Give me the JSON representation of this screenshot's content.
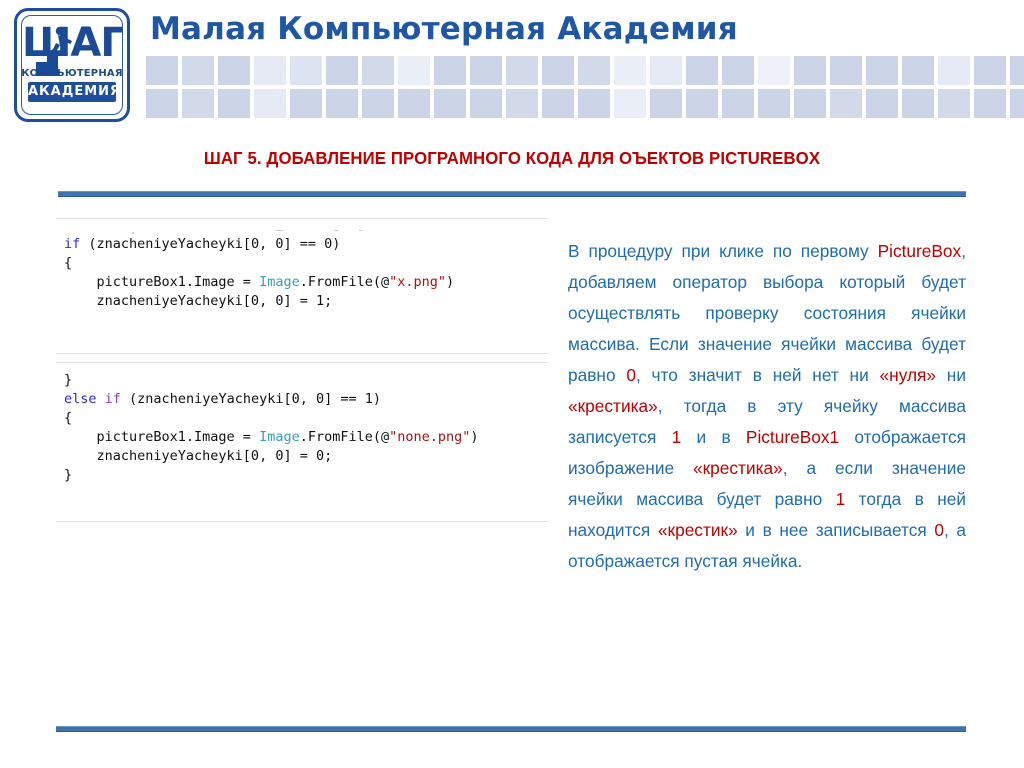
{
  "header": {
    "academy_title": "Малая Компьютерная Академия",
    "logo": {
      "main_word": "ШАГ",
      "line1": "КОМПЬЮТЕРНАЯ",
      "line2": "АКАДЕМИЯ"
    },
    "accent_blue": "#1f57a4",
    "checker_rows": [
      [
        "#ccd4e8",
        "#d2dae9",
        "#ccd4e8",
        "#e6eaf5",
        "#dde3f0",
        "#ccd4e8",
        "#d2dae9",
        "#eaeef7",
        "#ccd4e8",
        "#ccd4e8",
        "#d2dae9",
        "#ccd4e8",
        "#d2dae9",
        "#eaeef7",
        "#e6eaf5",
        "#ccd4e8",
        "#ccd4e8",
        "#eef1f8",
        "#ccd4e8",
        "#ccd4e8",
        "#ccd4e8",
        "#ccd4e8",
        "#e6eaf5",
        "#ccd4e8",
        "#ccd4e8",
        "#eaeef7"
      ],
      [
        "#ccd4e8",
        "#d2dae9",
        "#ccd4e8",
        "#e6eaf5",
        "#ccd4e8",
        "#ccd4e8",
        "#ccd4e8",
        "#ccd4e8",
        "#ccd4e8",
        "#ccd4e8",
        "#d2dae9",
        "#ccd4e8",
        "#ccd4e8",
        "#eaeef7",
        "#ccd4e8",
        "#ccd4e8",
        "#ccd4e8",
        "#ccd4e8",
        "#ccd4e8",
        "#d2dae9",
        "#ccd4e8",
        "#ccd4e8",
        "#d2dae9",
        "#ccd4e8",
        "#ccd4e8"
      ]
    ]
  },
  "slide": {
    "title": "ШАГ 5. ДОБАВЛЕНИЕ ПРОГРАМНОГО КОДА ДЛЯ ОЪЕКТОВ PICTUREBOX",
    "title_color": "#c00000",
    "rule_color": "#3f72af"
  },
  "code_block_1": {
    "lines": [
      {
        "segments": [
          {
            "t": "        .                 —      -  -",
            "c": "faded"
          }
        ]
      },
      {
        "segments": [
          {
            "t": "if",
            "c": "kw"
          },
          {
            "t": " (znacheniyeYacheyki[0, 0] == 0)",
            "c": ""
          }
        ]
      },
      {
        "segments": [
          {
            "t": "{",
            "c": ""
          }
        ]
      },
      {
        "segments": [
          {
            "t": "    pictureBox1.Image = ",
            "c": ""
          },
          {
            "t": "Image",
            "c": "type"
          },
          {
            "t": ".FromFile(@",
            "c": ""
          },
          {
            "t": "\"x.png\"",
            "c": "str"
          },
          {
            "t": ")",
            "c": ""
          }
        ]
      },
      {
        "segments": [
          {
            "t": "    znacheniyeYacheyki[0, 0] = 1;",
            "c": ""
          }
        ]
      }
    ]
  },
  "code_block_2": {
    "lines": [
      {
        "segments": [
          {
            "t": "}",
            "c": ""
          }
        ]
      },
      {
        "segments": [
          {
            "t": "else",
            "c": "kw"
          },
          {
            "t": " ",
            "c": ""
          },
          {
            "t": "if",
            "c": "kw2"
          },
          {
            "t": " (znacheniyeYacheyki[0, 0] == 1)",
            "c": ""
          }
        ]
      },
      {
        "segments": [
          {
            "t": "{",
            "c": ""
          }
        ]
      },
      {
        "segments": [
          {
            "t": "    pictureBox1.Image = ",
            "c": ""
          },
          {
            "t": "Image",
            "c": "type"
          },
          {
            "t": ".FromFile(@",
            "c": ""
          },
          {
            "t": "\"none.png\"",
            "c": "str"
          },
          {
            "t": ")",
            "c": ""
          }
        ]
      },
      {
        "segments": [
          {
            "t": "    znacheniyeYacheyki[0, 0] = 0;",
            "c": ""
          }
        ]
      },
      {
        "segments": [
          {
            "t": "}",
            "c": ""
          }
        ]
      }
    ]
  },
  "explanation": {
    "body_color": "#1f6cb0",
    "highlight_color": "#c00000",
    "segments": [
      {
        "t": "В процедуру при клике по первому ",
        "hl": false
      },
      {
        "t": "PictureBox",
        "hl": true
      },
      {
        "t": ", добавляем оператор выбора который будет осуществлять проверку состояния ячейки массива. Если значение ячейки массива будет равно ",
        "hl": false
      },
      {
        "t": "0",
        "hl": true
      },
      {
        "t": ", что значит в ней нет ни ",
        "hl": false
      },
      {
        "t": "«нуля»",
        "hl": true
      },
      {
        "t": " ни ",
        "hl": false
      },
      {
        "t": "«крестика»",
        "hl": true
      },
      {
        "t": ", тогда в эту ячейку массива записуется ",
        "hl": false
      },
      {
        "t": "1",
        "hl": true
      },
      {
        "t": " и в ",
        "hl": false
      },
      {
        "t": "PictureBox1",
        "hl": true
      },
      {
        "t": " отображается изображение ",
        "hl": false
      },
      {
        "t": "«крестика»",
        "hl": true
      },
      {
        "t": ", а если значение ячейки массива будет равно ",
        "hl": false
      },
      {
        "t": "1",
        "hl": true
      },
      {
        "t": " тогда в ней  находится ",
        "hl": false
      },
      {
        "t": "«крестик»",
        "hl": true
      },
      {
        "t": " и в нее записывается ",
        "hl": false
      },
      {
        "t": "0",
        "hl": true
      },
      {
        "t": ", а отображается пустая ячейка.",
        "hl": false
      }
    ]
  }
}
